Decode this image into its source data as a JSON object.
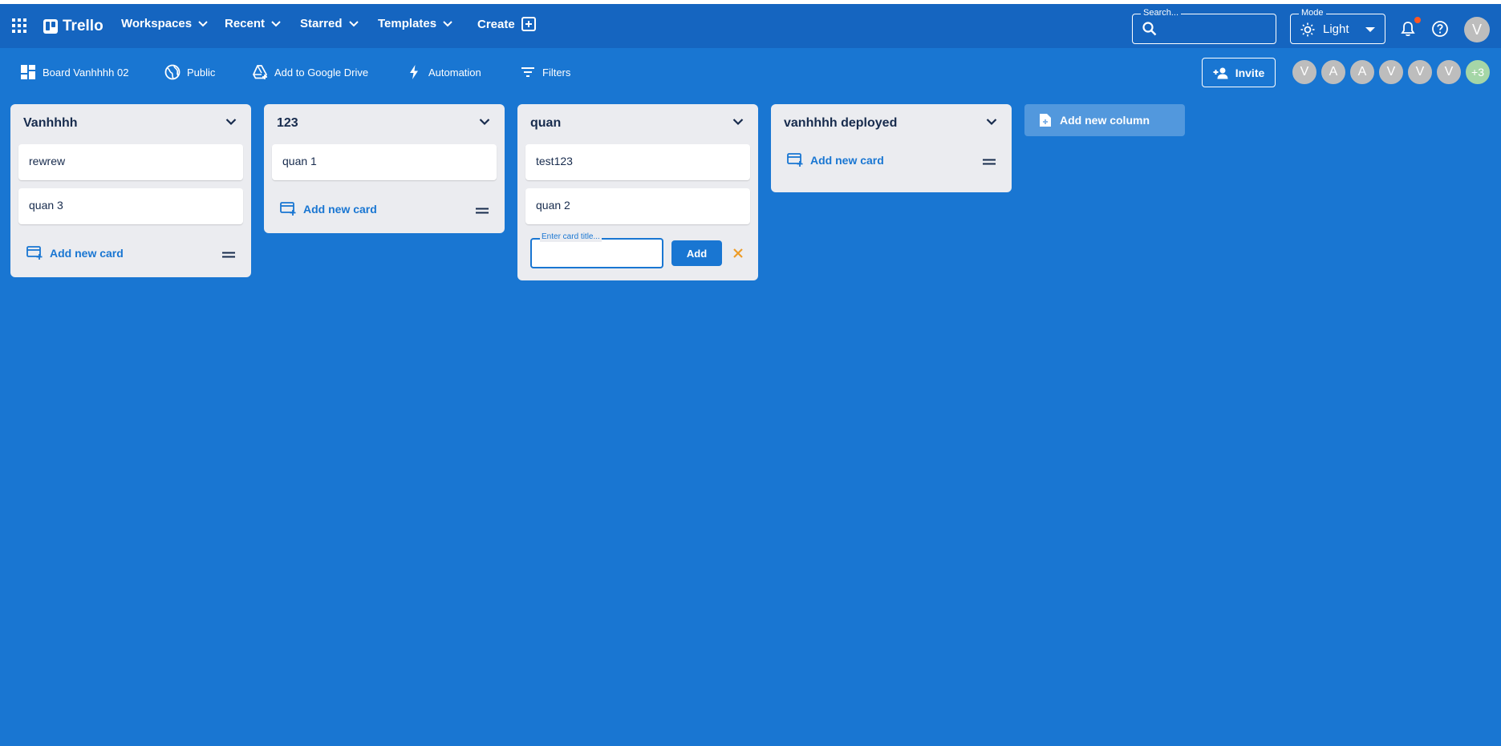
{
  "appbar": {
    "logo_text": "Trello",
    "nav": [
      {
        "label": "Workspaces"
      },
      {
        "label": "Recent"
      },
      {
        "label": "Starred"
      },
      {
        "label": "Templates"
      },
      {
        "label": "Create"
      }
    ],
    "search": {
      "label": "Search..."
    },
    "mode": {
      "label": "Mode",
      "value": "Light"
    },
    "user_initial": "V"
  },
  "boardbar": {
    "board_name": "Board Vanhhhh 02",
    "visibility": "Public",
    "google_drive": "Add to Google Drive",
    "automation": "Automation",
    "filters": "Filters",
    "invite_label": "Invite",
    "members": [
      "V",
      "A",
      "A",
      "V",
      "V",
      "V"
    ],
    "more_members": "+3"
  },
  "columns": [
    {
      "title": "Vanhhhh",
      "cards": [
        "rewrew",
        "quan 3"
      ],
      "add_card_label": "Add new card"
    },
    {
      "title": "123",
      "cards": [
        "quan 1"
      ],
      "add_card_label": "Add new card"
    },
    {
      "title": "quan",
      "cards": [
        "test123",
        "quan 2"
      ],
      "new_card_label": "Enter card title...",
      "add_button": "Add"
    },
    {
      "title": "vanhhhh deployed",
      "cards": [],
      "add_card_label": "Add new card"
    }
  ],
  "add_column_label": "Add new column",
  "colors": {
    "background": "#1976d2",
    "appbar": "#1565c0",
    "column": "#ebecf0",
    "accent": "#1976d2",
    "close": "#ed9c28",
    "notification": "#ff5722"
  }
}
